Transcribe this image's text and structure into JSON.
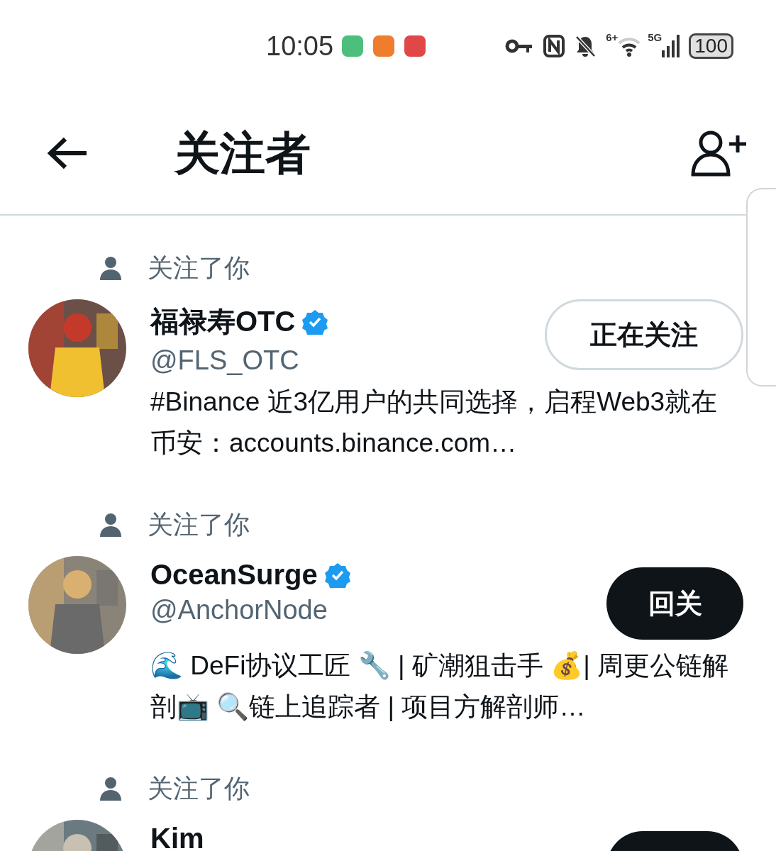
{
  "status_bar": {
    "time": "10:05",
    "notifications": [
      {
        "color": "#4cbf7c"
      },
      {
        "color": "#ee7d2e"
      },
      {
        "color": "#e04848"
      }
    ],
    "wifi_label": "6+",
    "cell_label": "5G",
    "battery": "100"
  },
  "header": {
    "title": "关注者"
  },
  "followers": [
    {
      "context": "关注了你",
      "name": "福禄寿OTC",
      "verified": true,
      "handle": "@FLS_OTC",
      "bio": "#Binance 近3亿用户的共同选择，启程Web3就在币安：accounts.binance.com…",
      "button": {
        "kind": "following",
        "label": "正在关注"
      }
    },
    {
      "context": "关注了你",
      "name": "OceanSurge",
      "verified": true,
      "handle": "@AnchorNode",
      "bio": "🌊 DeFi协议工匠 🔧 | 矿潮狙击手 💰| 周更公链解剖📺 🔍链上追踪者 | 项目方解剖师…",
      "button": {
        "kind": "follow_back",
        "label": "回关"
      }
    },
    {
      "context": "关注了你",
      "name": "Kim",
      "verified": false,
      "button": {
        "kind": "follow_back"
      }
    }
  ]
}
